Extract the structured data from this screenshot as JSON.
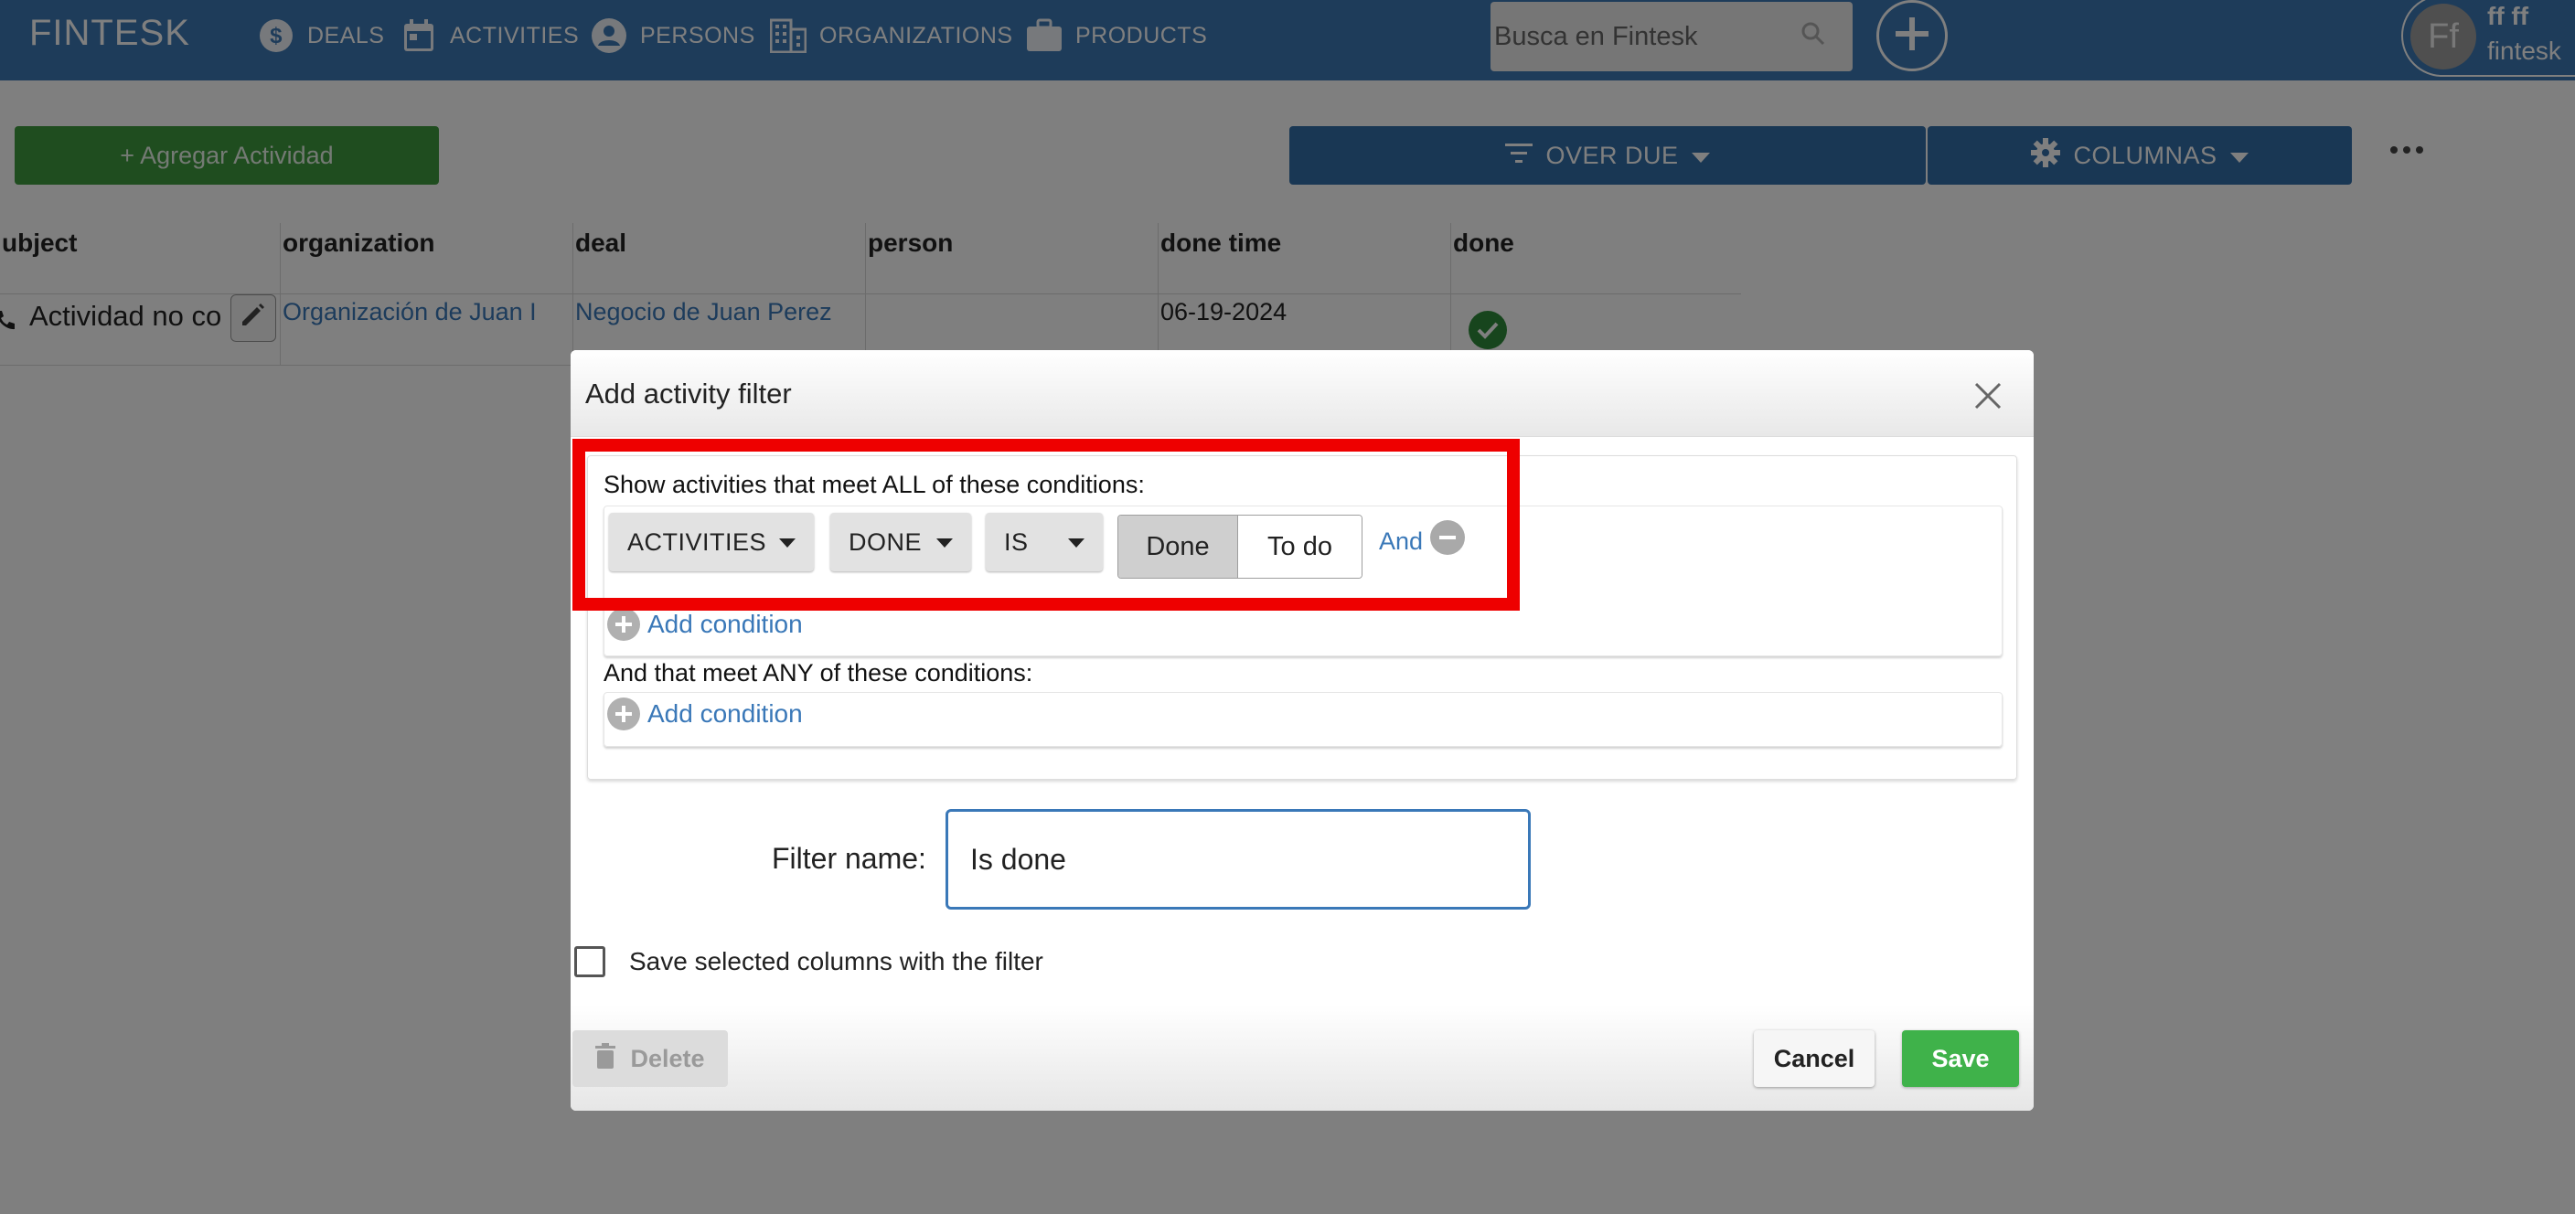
{
  "nav": {
    "brand": "FINTESK",
    "items": [
      {
        "label": "DEALS",
        "icon": "dollar-icon"
      },
      {
        "label": "ACTIVITIES",
        "icon": "calendar-icon"
      },
      {
        "label": "PERSONS",
        "icon": "person-icon"
      },
      {
        "label": "ORGANIZATIONS",
        "icon": "building-icon"
      },
      {
        "label": "PRODUCTS",
        "icon": "briefcase-icon"
      }
    ],
    "search_placeholder": "Busca en Fintesk",
    "user": {
      "initials": "Ff",
      "name": "ff ff",
      "company": "fintesk"
    }
  },
  "toolbar": {
    "add_activity": "+ Agregar Actividad",
    "filter_label": "OVER DUE",
    "columns_label": "COLUMNAS"
  },
  "table": {
    "headers": [
      "ubject",
      "organization",
      "deal",
      "person",
      "done time",
      "done"
    ],
    "rows": [
      {
        "subject": "Actividad no co",
        "organization": "Organización de Juan I",
        "deal": "Negocio de Juan Perez",
        "person": "",
        "done_time": "06-19-2024",
        "done": true
      }
    ]
  },
  "modal": {
    "title": "Add activity filter",
    "all_title": "Show activities that meet ALL of these conditions:",
    "condition": {
      "field_group": "ACTIVITIES",
      "field": "DONE",
      "operator": "IS",
      "options": [
        "Done",
        "To do"
      ],
      "selected": "Done",
      "conjunction": "And"
    },
    "add_condition": "Add condition",
    "any_title": "And that meet ANY of these conditions:",
    "filter_name_label": "Filter name:",
    "filter_name_value": "Is done",
    "save_columns_label": "Save selected columns with the filter",
    "delete_label": "Delete",
    "cancel_label": "Cancel",
    "save_label": "Save"
  },
  "colors": {
    "nav_blue": "#3c78b4",
    "primary_blue": "#336ea8",
    "add_green": "#3f9b3f",
    "save_green": "#3fb24a",
    "highlight_red": "#ee0000"
  }
}
